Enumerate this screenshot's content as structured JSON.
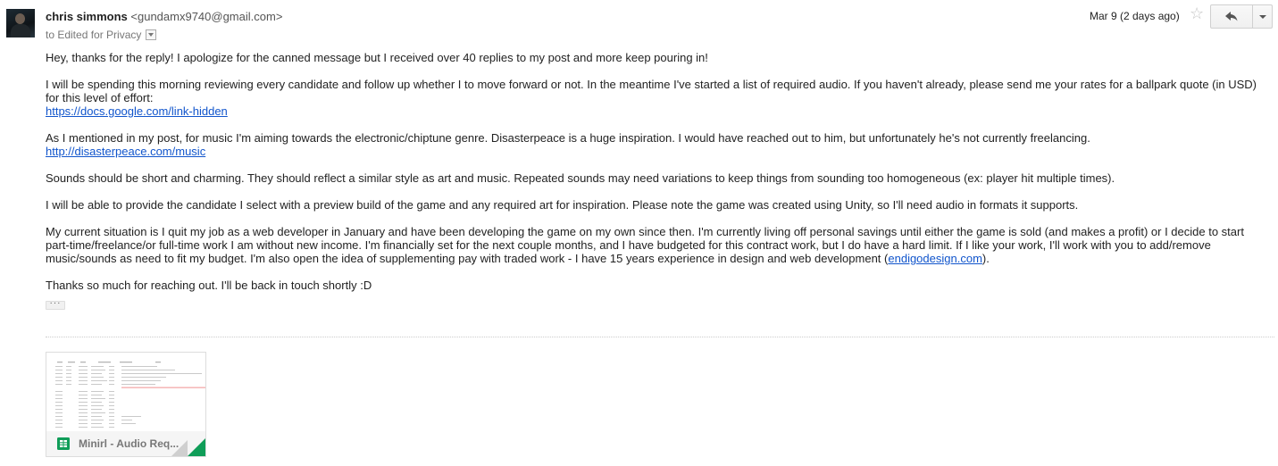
{
  "message": {
    "sender": {
      "name": "chris simmons",
      "email": "<gundamx9740@gmail.com>"
    },
    "to": "to Edited for Privacy",
    "date": "Mar 9 (2 days ago)",
    "icons": {
      "star": "star-outline-icon",
      "reply": "reply-arrow-icon",
      "more": "chevron-down-icon",
      "avatar": "sender-avatar"
    },
    "body": {
      "p1": "Hey, thanks for the reply! I apologize for the canned message but I received over 40 replies to my post and more keep pouring in!",
      "p2": "I will be spending this morning reviewing every candidate and follow up whether I to move forward or not. In the meantime I've started a list of required audio. If you haven't already, please send me your rates for a ballpark quote (in USD) for this level of effort:",
      "p2_link": "https://docs.google.com/link-hidden",
      "p3": "As I mentioned in my post, for music I'm aiming towards the electronic/chiptune genre. Disasterpeace is a huge inspiration. I would have reached out to him, but unfortunately he's not currently freelancing.",
      "p3_link": "http://disasterpeace.com/music",
      "p4": "Sounds should be short and charming. They should reflect a similar style as art and music. Repeated sounds may need variations to keep things from sounding too homogeneous (ex: player hit multiple times).",
      "p5": "I will be able to provide the candidate I select with a preview build of the game and any required art for inspiration. Please note the game was created using Unity, so I'll need audio in formats it supports.",
      "p6": "My current situation is I quit my job as a web developer in January and have been developing the game on my own since then. I'm currently living off personal savings until either the game is sold (and makes a profit) or I decide to start part-time/freelance/or full-time work I am without new income. I'm financially set for the next couple months, and I have budgeted for this contract work, but I do have a hard limit. If I like your work, I'll work with you to add/remove music/sounds as need to fit my budget. I'm also open the idea of supplementing pay with traded work - I have 15 years experience in design and web development (",
      "p6_link": "endigodesign.com",
      "p6_end": ").",
      "p7": "Thanks so much for reaching out. I'll be back in touch shortly :D"
    },
    "trimmed_content_label": "···",
    "attachment": {
      "name": "Minirl - Audio Req...",
      "icon": "google-sheets-icon",
      "accent": "#0f9d58"
    }
  }
}
